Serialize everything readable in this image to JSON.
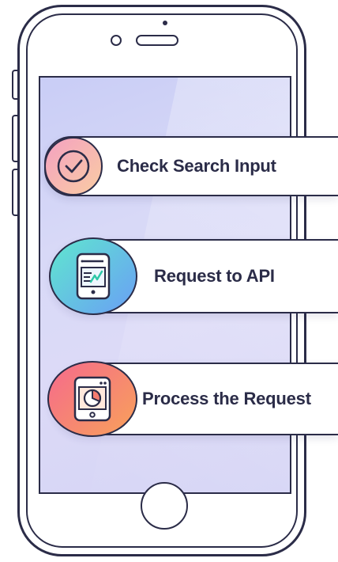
{
  "steps": [
    {
      "label": "Check Search Input",
      "icon": "checkmark-icon"
    },
    {
      "label": "Request to API",
      "icon": "tablet-chart-icon"
    },
    {
      "label": "Process the Request",
      "icon": "tablet-pie-chart-icon"
    }
  ],
  "colors": {
    "outline": "#2b2c48",
    "screen": "#d3d4f6",
    "badge1": [
      "#f5a8c2",
      "#f8c7a6"
    ],
    "badge2": [
      "#5fe3d2",
      "#6aa8f4"
    ],
    "badge3": [
      "#f3758a",
      "#f7a25b"
    ]
  }
}
